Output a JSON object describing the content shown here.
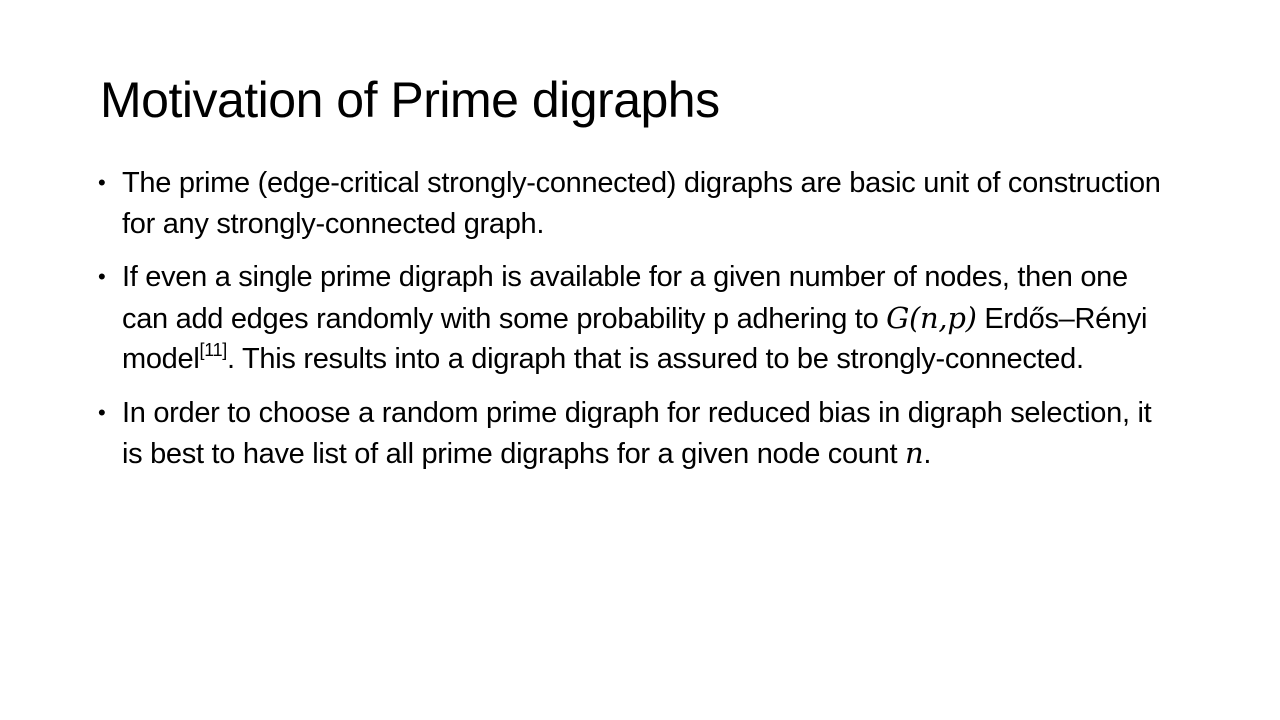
{
  "slide": {
    "title": "Motivation of Prime digraphs",
    "bullet_symbol": "•",
    "bullets": [
      {
        "text": "The prime (edge-critical strongly-connected) digraphs are basic unit of construction for any strongly-connected graph."
      },
      {
        "text_before_math": "If even a single prime digraph is available for a given number of nodes, then one can add edges randomly with some probability p adhering to ",
        "math": "G(n,p)",
        "text_after_math": " Erdős–Rényi model",
        "citation": "[11]",
        "text_after_citation": ". This results into a digraph that is assured to be strongly-connected."
      },
      {
        "text_before_math": "In order to choose a random prime digraph for reduced bias in digraph selection, it is best to have list of all prime digraphs for a given node count ",
        "math": "n",
        "text_after_math": "."
      }
    ]
  }
}
